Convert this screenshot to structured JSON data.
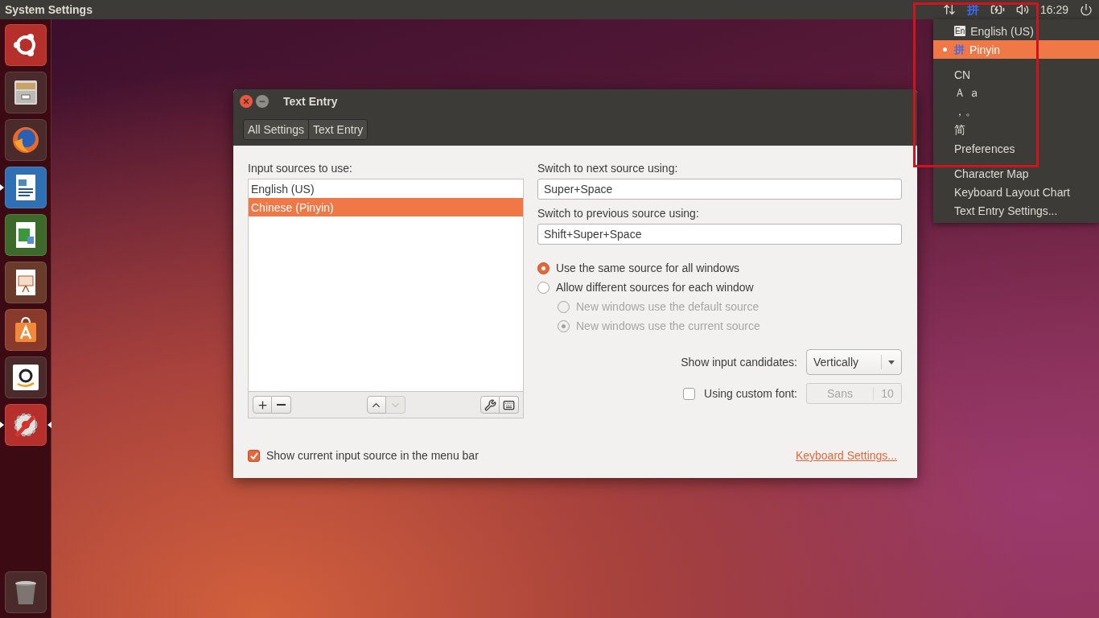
{
  "top_bar": {
    "app_title": "System Settings",
    "input_indicator": "拼",
    "clock": "16:29"
  },
  "launcher": [
    {
      "kind": "dash",
      "running": false,
      "focused": false
    },
    {
      "kind": "files",
      "running": false,
      "focused": false
    },
    {
      "kind": "browser",
      "running": false,
      "focused": false
    },
    {
      "kind": "writer",
      "running": true,
      "focused": false
    },
    {
      "kind": "calc",
      "running": false,
      "focused": false
    },
    {
      "kind": "impress",
      "running": false,
      "focused": false
    },
    {
      "kind": "software",
      "running": false,
      "focused": false
    },
    {
      "kind": "shop",
      "running": false,
      "focused": false
    },
    {
      "kind": "settings",
      "running": true,
      "focused": true
    },
    {
      "kind": "trash",
      "running": false,
      "focused": false
    }
  ],
  "window": {
    "title": "Text Entry",
    "breadcrumbs": [
      "All Settings",
      "Text Entry"
    ],
    "input_sources": {
      "label": "Input sources to use:",
      "items": [
        {
          "name": "English (US)",
          "selected": false
        },
        {
          "name": "Chinese (Pinyin)",
          "selected": true
        }
      ]
    },
    "list_buttons": [
      {
        "kind": "add",
        "disabled": false
      },
      {
        "kind": "remove",
        "disabled": false
      },
      {
        "kind": "up",
        "disabled": false
      },
      {
        "kind": "down",
        "disabled": true
      },
      {
        "kind": "configure",
        "disabled": false
      },
      {
        "kind": "layout",
        "disabled": false
      }
    ],
    "next_source": {
      "label": "Switch to next source using:",
      "value": "Super+Space"
    },
    "prev_source": {
      "label": "Switch to previous source using:",
      "value": "Shift+Super+Space"
    },
    "window_mode": [
      {
        "label": "Use the same source for all windows",
        "selected": true,
        "disabled": false
      },
      {
        "label": "Allow different sources for each window",
        "selected": false,
        "disabled": false
      }
    ],
    "new_window_mode": [
      {
        "label": "New windows use the default source",
        "selected": false,
        "disabled": true
      },
      {
        "label": "New windows use the current source",
        "selected": true,
        "disabled": true
      }
    ],
    "candidates": {
      "label": "Show input candidates:",
      "value": "Vertically"
    },
    "custom_font": {
      "label": "Using custom font:",
      "checked": false,
      "font": "Sans",
      "size": "10",
      "disabled": true
    },
    "show_in_menu_bar": {
      "label": "Show current input source in the menu bar",
      "checked": true
    },
    "keyboard_settings_link": "Keyboard Settings..."
  },
  "menu": {
    "items": [
      {
        "kind": "source",
        "badge": "En",
        "label": "English (US)",
        "selected": false
      },
      {
        "kind": "source",
        "badge": "拼",
        "label": "Pinyin",
        "selected": true
      },
      {
        "kind": "separator"
      },
      {
        "kind": "item",
        "label": "CN"
      },
      {
        "kind": "item",
        "label": "Ａ ａ"
      },
      {
        "kind": "item",
        "label": "，。"
      },
      {
        "kind": "item",
        "label": "简"
      },
      {
        "kind": "item",
        "label": "Preferences"
      },
      {
        "kind": "separator"
      },
      {
        "kind": "item",
        "label": "Character Map"
      },
      {
        "kind": "item",
        "label": "Keyboard Layout Chart"
      },
      {
        "kind": "item",
        "label": "Text Entry Settings..."
      }
    ]
  }
}
